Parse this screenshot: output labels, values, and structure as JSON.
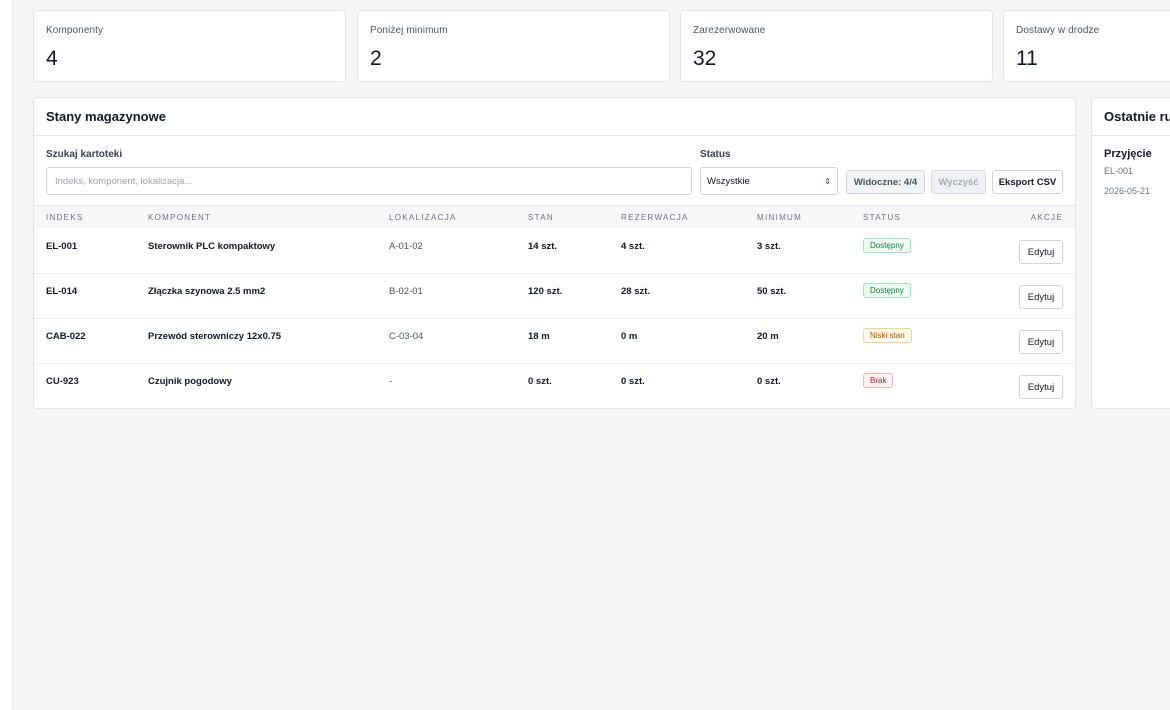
{
  "kpis": [
    {
      "label": "Komponenty",
      "value": "4"
    },
    {
      "label": "Poniżej minimum",
      "value": "2"
    },
    {
      "label": "Zarezerwowane",
      "value": "32"
    },
    {
      "label": "Dostawy w drodze",
      "value": "11"
    }
  ],
  "inventory": {
    "title": "Stany magazynowe",
    "search": {
      "label": "Szukaj kartoteki",
      "placeholder": "Indeks, komponent, lokalizacja...",
      "value": ""
    },
    "status": {
      "label": "Status",
      "selected": "Wszystkie"
    },
    "visible_label": "Widoczne: 4/4",
    "clear_label": "Wyczyść",
    "export_label": "Eksport CSV",
    "columns": [
      "Indeks",
      "Komponent",
      "Lokalizacja",
      "Stan",
      "Rezerwacja",
      "Minimum",
      "Status",
      "Akcje"
    ],
    "rows": [
      {
        "index": "EL-001",
        "component": "Sterownik PLC kompaktowy",
        "location": "A-01-02",
        "stock": "14 szt.",
        "reserved": "4 szt.",
        "minimum": "3 szt.",
        "status": "Dostępny",
        "status_type": "ok",
        "action": "Edytuj"
      },
      {
        "index": "EL-014",
        "component": "Złączka szynowa 2.5 mm2",
        "location": "B-02-01",
        "stock": "120 szt.",
        "reserved": "28 szt.",
        "minimum": "50 szt.",
        "status": "Dostępny",
        "status_type": "ok",
        "action": "Edytuj"
      },
      {
        "index": "CAB-022",
        "component": "Przewód sterowniczy 12x0.75",
        "location": "C-03-04",
        "stock": "18 m",
        "reserved": "0 m",
        "minimum": "20 m",
        "status": "Niski stan",
        "status_type": "warn",
        "action": "Edytuj"
      },
      {
        "index": "CU-923",
        "component": "Czujnik pogodowy",
        "location": "-",
        "stock": "0 szt.",
        "reserved": "0 szt.",
        "minimum": "0 szt.",
        "status": "Brak",
        "status_type": "bad",
        "action": "Edytuj"
      }
    ]
  },
  "movements": {
    "title": "Ostatnie ruchy",
    "items": [
      {
        "type": "Przyjęcie",
        "index": "EL-001",
        "date": "2026-05-21"
      }
    ]
  },
  "colors": {
    "ok": "#15803d",
    "warn": "#b45309",
    "bad": "#b91c1c"
  }
}
